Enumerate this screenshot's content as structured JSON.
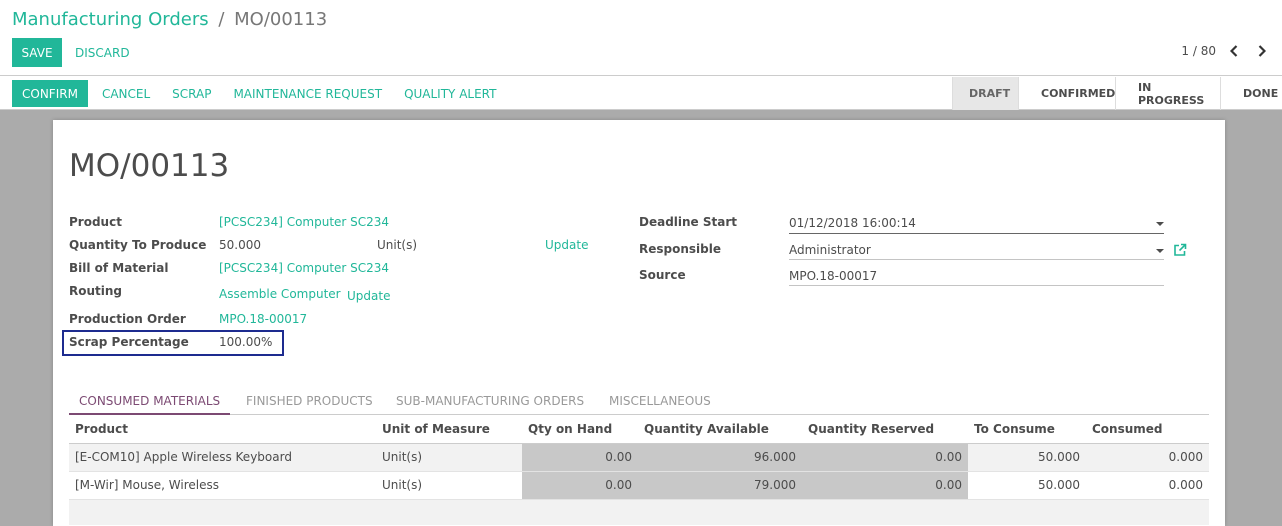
{
  "breadcrumb": {
    "parent": "Manufacturing Orders",
    "separator": "/",
    "current": "MO/00113"
  },
  "buttons": {
    "save": "SAVE",
    "discard": "DISCARD"
  },
  "pager": {
    "value": "1 / 80",
    "prev_icon": "chevron-left-icon",
    "next_icon": "chevron-right-icon"
  },
  "statusbar": {
    "confirm": "CONFIRM",
    "cancel": "CANCEL",
    "scrap": "SCRAP",
    "maintenance": "MAINTENANCE REQUEST",
    "quality": "QUALITY ALERT",
    "stages": [
      "DRAFT",
      "CONFIRMED",
      "IN PROGRESS",
      "DONE"
    ],
    "active_stage": "DRAFT"
  },
  "form": {
    "title": "MO/00113",
    "product_label": "Product",
    "product_value": "[PCSC234] Computer SC234",
    "qty_label": "Quantity To Produce",
    "qty_value": "50.000",
    "qty_uom": "Unit(s)",
    "qty_update": "Update",
    "bom_label": "Bill of Material",
    "bom_value": "[PCSC234] Computer SC234",
    "routing_label": "Routing",
    "routing_value": "Assemble Computer",
    "routing_update": "Update",
    "production_order_label": "Production Order",
    "production_order_value": "MPO.18-00017",
    "scrap_label": "Scrap Percentage",
    "scrap_value": "100.00%",
    "deadline_label": "Deadline Start",
    "deadline_value": "01/12/2018 16:00:14",
    "responsible_label": "Responsible",
    "responsible_value": "Administrator",
    "source_label": "Source",
    "source_value": "MPO.18-00017"
  },
  "tabs": [
    "CONSUMED MATERIALS",
    "FINISHED PRODUCTS",
    "SUB-MANUFACTURING ORDERS",
    "MISCELLANEOUS"
  ],
  "table": {
    "headers": [
      "Product",
      "Unit of Measure",
      "Qty on Hand",
      "Quantity Available",
      "Quantity Reserved",
      "To Consume",
      "Consumed"
    ],
    "rows": [
      [
        "[E-COM10] Apple Wireless Keyboard",
        "Unit(s)",
        "0.00",
        "96.000",
        "0.00",
        "50.000",
        "0.000"
      ],
      [
        "[M-Wir] Mouse, Wireless",
        "Unit(s)",
        "0.00",
        "79.000",
        "0.00",
        "50.000",
        "0.000"
      ]
    ]
  },
  "colors": {
    "accent": "#21b799",
    "tab_active": "#7c4a73",
    "highlight_box": "#1d2b8f"
  }
}
